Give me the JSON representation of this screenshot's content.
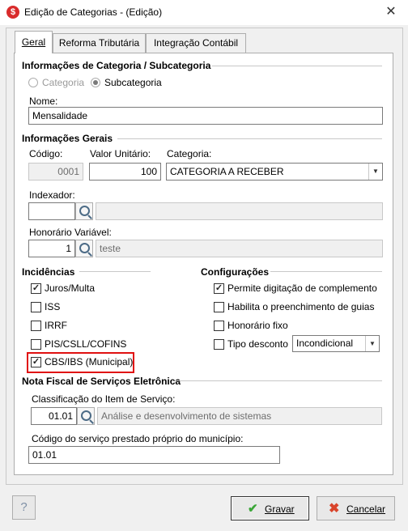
{
  "window": {
    "title": "Edição de Categorias - (Edição)",
    "close_glyph": "✕",
    "app_icon": "$"
  },
  "tabs": [
    {
      "label": "Geral"
    },
    {
      "label": "Reforma Tributária"
    },
    {
      "label": "Integração Contábil"
    }
  ],
  "cat_info": {
    "heading": "Informações de Categoria / Subcategoria",
    "radio_categoria": "Categoria",
    "radio_subcategoria": "Subcategoria",
    "nome_label": "Nome:",
    "nome_value": "Mensalidade"
  },
  "general": {
    "heading": "Informações Gerais",
    "codigo_label": "Código:",
    "codigo_value": "0001",
    "valor_label": "Valor Unitário:",
    "valor_value": "100",
    "categoria_label": "Categoria:",
    "categoria_value": "CATEGORIA A RECEBER",
    "indexador_label": "Indexador:",
    "indexador_value": "",
    "honorario_label": "Honorário Variável:",
    "honorario_value": "1",
    "honorario_desc": "teste"
  },
  "incidencias": {
    "heading": "Incidências",
    "items": [
      {
        "label": "Juros/Multa",
        "checked": true
      },
      {
        "label": "ISS",
        "checked": false
      },
      {
        "label": "IRRF",
        "checked": false
      },
      {
        "label": "PIS/CSLL/COFINS",
        "checked": false
      },
      {
        "label": "CBS/IBS (Municipal)",
        "checked": true
      }
    ]
  },
  "configuracoes": {
    "heading": "Configurações",
    "items": [
      {
        "label": "Permite digitação de complemento",
        "checked": true
      },
      {
        "label": "Habilita o preenchimento de guias",
        "checked": false
      },
      {
        "label": "Honorário fixo",
        "checked": false
      },
      {
        "label": "Tipo desconto",
        "checked": false
      }
    ],
    "tipo_desconto_value": "Incondicional"
  },
  "nfse": {
    "heading": "Nota Fiscal de Serviços Eletrônica",
    "classificacao_label": "Classificação do Item de Serviço:",
    "classificacao_code": "01.01",
    "classificacao_desc": "Análise e desenvolvimento de sistemas",
    "codigo_servico_label": "Código do serviço prestado próprio do município:",
    "codigo_servico_value": "01.01"
  },
  "footer": {
    "help_label": "?",
    "gravar_label": "Gravar",
    "cancelar_label": "Cancelar"
  },
  "colors": {
    "highlight": "#e01010",
    "gravar_check": "#3aa637",
    "cancel_x": "#d9442b",
    "app_icon": "#d92b2b"
  }
}
